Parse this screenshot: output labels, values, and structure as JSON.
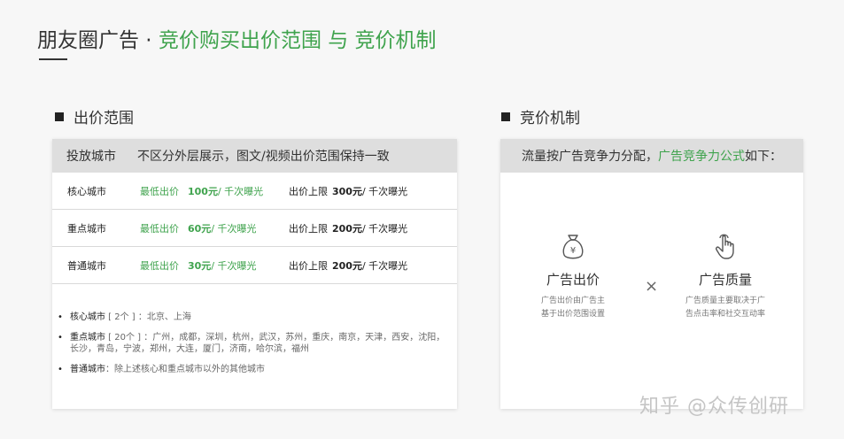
{
  "title": {
    "prefix": "朋友圈广告 · ",
    "highlight": "竞价购买出价范围 与 竞价机制"
  },
  "left_section": {
    "heading": "出价范围",
    "header_col1": "投放城市",
    "header_col2": "不区分外层展示，图文/视频出价范围保持一致",
    "rows": [
      {
        "city": "核心城市",
        "min_label": "最低出价",
        "min_value": "100元",
        "min_unit": " / 千次曝光",
        "max_label": "出价上限",
        "max_value": "300元",
        "max_unit": " / 千次曝光"
      },
      {
        "city": "重点城市",
        "min_label": "最低出价",
        "min_value": "60元",
        "min_unit": " / 千次曝光",
        "max_label": "出价上限",
        "max_value": "200元",
        "max_unit": " / 千次曝光"
      },
      {
        "city": "普通城市",
        "min_label": "最低出价",
        "min_value": "30元",
        "min_unit": " / 千次曝光",
        "max_label": "出价上限",
        "max_value": "200元",
        "max_unit": " / 千次曝光"
      }
    ],
    "notes": [
      {
        "key": "核心城市",
        "rest": " [ 2个 ] ：北京、上海"
      },
      {
        "key": "重点城市",
        "rest": " [ 20个 ] ：广州，成都，深圳，杭州，武汉，苏州，重庆，南京，天津，西安，沈阳，长沙，青岛，宁波，郑州，大连，厦门，济南，哈尔滨，福州"
      },
      {
        "key": "普通城市",
        "rest": "：除上述核心和重点城市以外的其他城市"
      }
    ]
  },
  "right_section": {
    "heading": "竞价机制",
    "header_prefix": "流量按广告竞争力分配，",
    "header_highlight": "广告竞争力公式",
    "header_suffix": "如下：",
    "factor1": {
      "name": "广告出价",
      "desc_line1": "广告出价由广告主",
      "desc_line2": "基于出价范围设置",
      "icon": "money-bag-icon"
    },
    "operator": "×",
    "factor2": {
      "name": "广告质量",
      "desc_line1": "广告质量主要取决于广",
      "desc_line2": "告点击率和社交互动率",
      "icon": "tap-hand-icon"
    }
  },
  "watermark": "知乎 @众传创研",
  "colors": {
    "accent": "#3fa34d",
    "header_bg": "#dedede",
    "page_bg": "#f7f7f7"
  }
}
